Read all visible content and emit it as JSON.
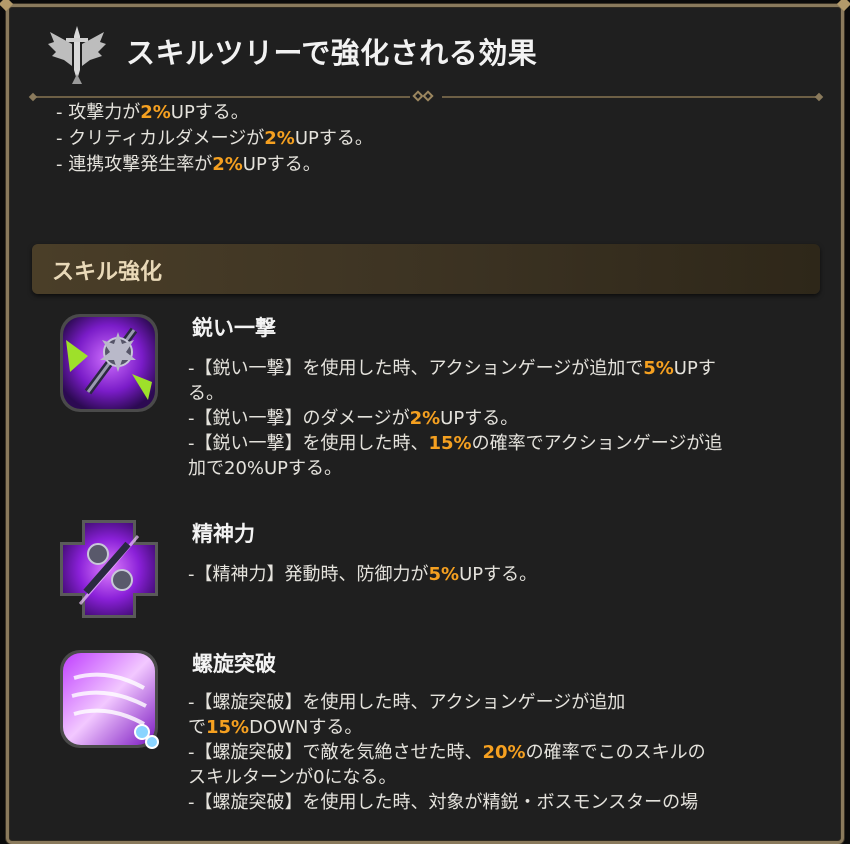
{
  "header": {
    "title": "スキルツリーで強化される効果"
  },
  "effects": [
    {
      "pre": "- 攻撃力が",
      "hl": "2%",
      "post": "UPする。"
    },
    {
      "pre": "- クリティカルダメージが",
      "hl": "2%",
      "post": "UPする。"
    },
    {
      "pre": "- 連携攻撃発生率が",
      "hl": "2%",
      "post": "UPする。"
    }
  ],
  "section": {
    "title": "スキル強化"
  },
  "skills": [
    {
      "name": "鋭い一撃",
      "icon": "spiked-mace-skill-icon",
      "lines": [
        {
          "pre": "-【鋭い一撃】を使用した時、アクションゲージが追加で",
          "hl": "5%",
          "post": "UPす"
        },
        {
          "pre": "る。",
          "hl": "",
          "post": ""
        },
        {
          "pre": "-【鋭い一撃】のダメージが",
          "hl": "2%",
          "post": "UPする。"
        },
        {
          "pre": "-【鋭い一撃】を使用した時、",
          "hl": "15%",
          "post": "の確率でアクションゲージが追"
        },
        {
          "pre": "加で20%UPする。",
          "hl": "",
          "post": ""
        }
      ]
    },
    {
      "name": "精神力",
      "icon": "mace-cross-skill-icon",
      "lines": [
        {
          "pre": "-【精神力】発動時、防御力が",
          "hl": "5%",
          "post": "UPする。"
        }
      ]
    },
    {
      "name": "螺旋突破",
      "icon": "spiral-slash-skill-icon",
      "lines": [
        {
          "pre": "-【螺旋突破】を使用した時、アクションゲージが追加",
          "hl": "",
          "post": ""
        },
        {
          "pre": "で",
          "hl": "15%",
          "post": "DOWNする。"
        },
        {
          "pre": "-【螺旋突破】で敵を気絶させた時、",
          "hl": "20%",
          "post": "の確率でこのスキルの"
        },
        {
          "pre": "スキルターンが0になる。",
          "hl": "",
          "post": ""
        },
        {
          "pre": "-【螺旋突破】を使用した時、対象が精鋭・ボスモンスターの場",
          "hl": "",
          "post": ""
        }
      ]
    }
  ],
  "colors": {
    "highlight": "#f5a020",
    "frame": "#8a7a5c",
    "panel": "#1f1f1f",
    "section": "#4a3e28"
  }
}
